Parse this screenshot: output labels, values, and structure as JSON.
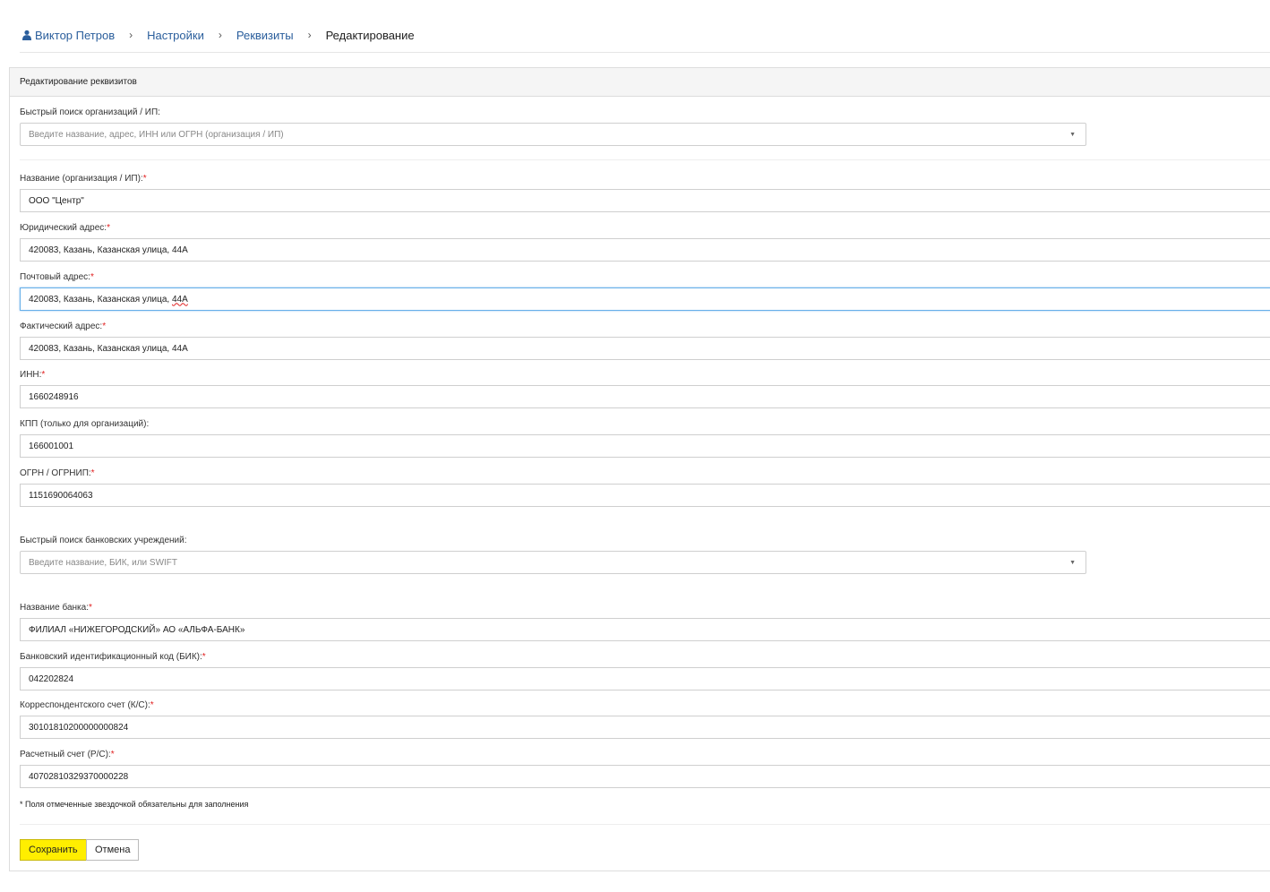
{
  "breadcrumb": {
    "user": "Виктор Петров",
    "settings": "Настройки",
    "requisites": "Реквизиты",
    "current": "Редактирование",
    "separator": "›"
  },
  "panel": {
    "title": "Редактирование реквизитов"
  },
  "org_search": {
    "label": "Быстрый поиск организаций / ИП:",
    "placeholder": "Введите название, адрес, ИНН или ОГРН (организация / ИП)"
  },
  "fields": {
    "name": {
      "label": "Название (организация / ИП):",
      "value": "ООО \"Центр\""
    },
    "legal_address": {
      "label": "Юридический адрес:",
      "value": "420083, Казань, Казанская улица, 44А"
    },
    "postal_address": {
      "label": "Почтовый адрес:",
      "value_main": "420083, Казань, Казанская улица, ",
      "value_tail": "44А"
    },
    "actual_address": {
      "label": "Фактический адрес:",
      "value": "420083, Казань, Казанская улица, 44А"
    },
    "inn": {
      "label": "ИНН:",
      "value": "1660248916"
    },
    "kpp": {
      "label": "КПП (только для организаций):",
      "value": "166001001"
    },
    "ogrn": {
      "label": "ОГРН / ОГРНИП:",
      "value": "1151690064063"
    }
  },
  "bank_search": {
    "label": "Быстрый поиск банковских учреждений:",
    "placeholder": "Введите название, БИК, или SWIFT"
  },
  "bank": {
    "name": {
      "label": "Название банка:",
      "value": "ФИЛИАЛ «НИЖЕГОРОДСКИЙ» АО «АЛЬФА-БАНК»"
    },
    "bik": {
      "label": "Банковский идентификационный код (БИК):",
      "value": "042202824"
    },
    "corr_account": {
      "label": "Корреспондентского счет (К/С):",
      "value": "30101810200000000824"
    },
    "account": {
      "label": "Расчетный счет (Р/С):",
      "value": "40702810329370000228"
    }
  },
  "required_mark": "*",
  "note": "* Поля отмеченные звездочкой обязательны для заполнения",
  "actions": {
    "save": "Сохранить",
    "cancel": "Отмена"
  },
  "icons": {
    "user": "user-icon",
    "caret": "chevron-down-icon"
  },
  "colors": {
    "link": "#2a5e9c",
    "required": "#e02020",
    "save_button": "#ffee00",
    "focus_border": "#66afe9"
  }
}
